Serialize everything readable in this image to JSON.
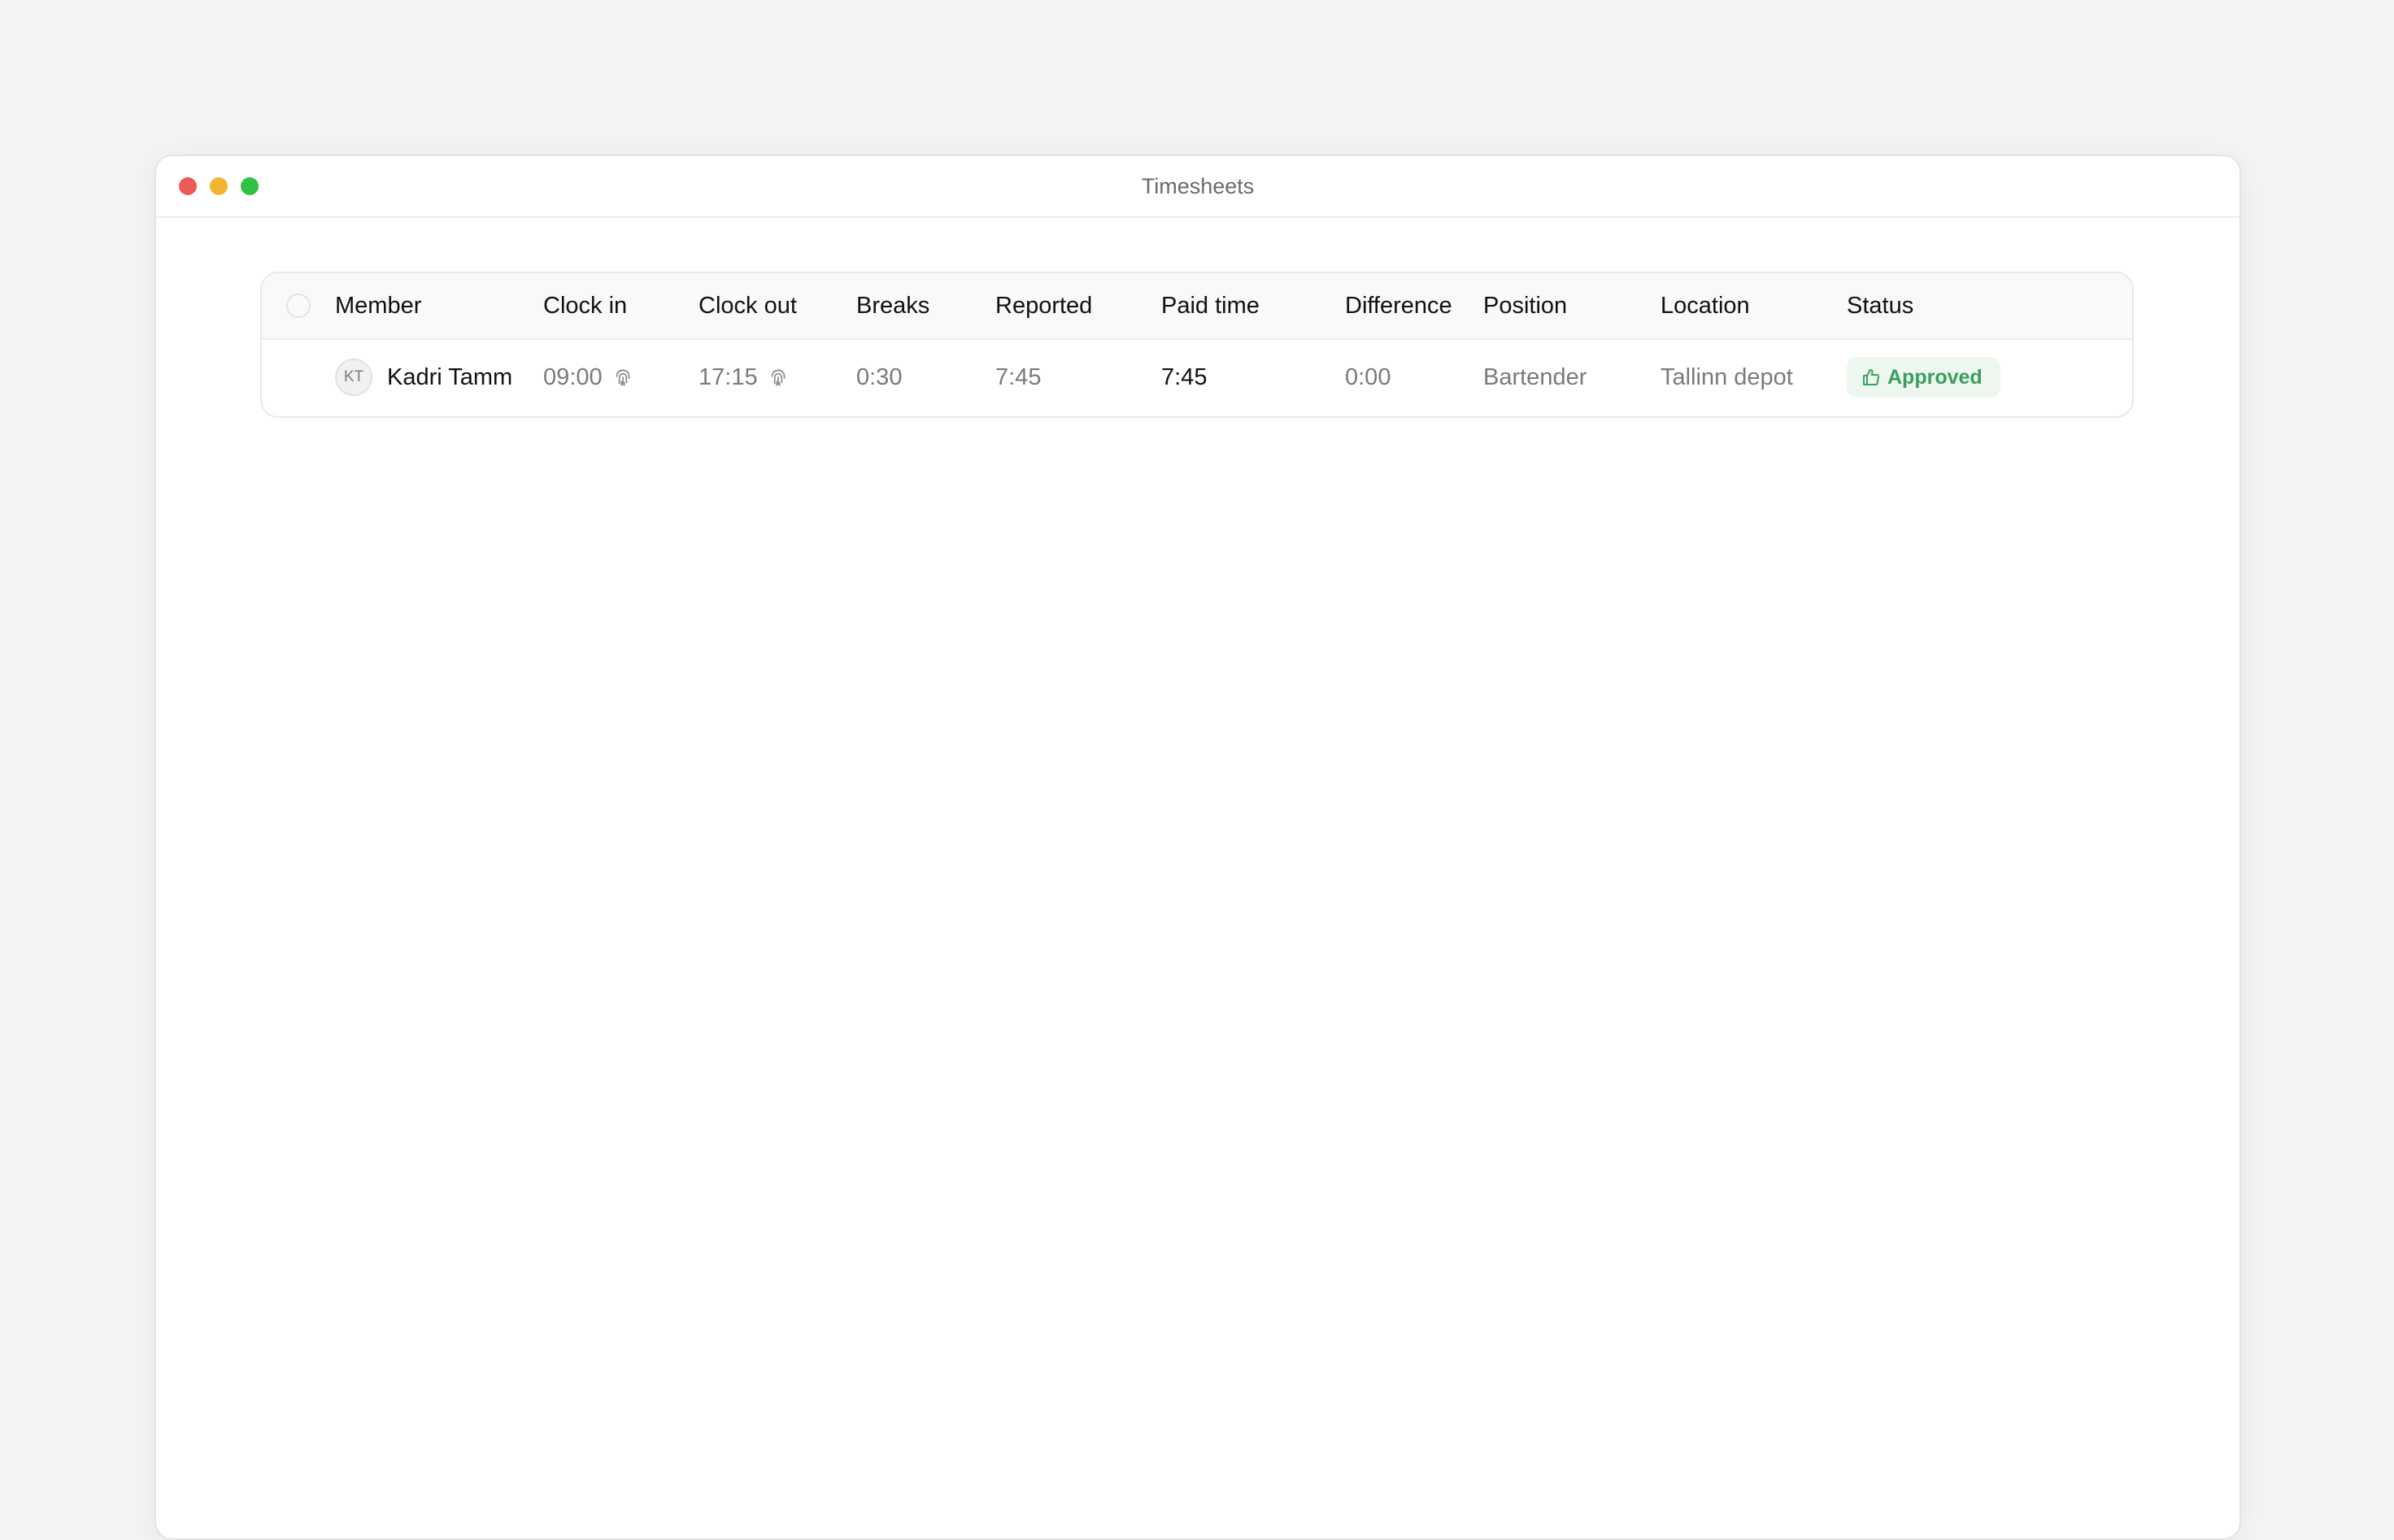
{
  "window": {
    "title": "Timesheets",
    "controls": {
      "close_color": "#ec5b55",
      "minimize_color": "#f3b52f",
      "maximize_color": "#30c242"
    }
  },
  "table": {
    "columns": [
      "Member",
      "Clock in",
      "Clock out",
      "Breaks",
      "Reported",
      "Paid time",
      "Difference",
      "Position",
      "Location",
      "Status"
    ],
    "rows": [
      {
        "member_initials": "KT",
        "member": "Kadri Tamm",
        "clock_in": "09:00",
        "clock_in_icon": "fingerprint-icon",
        "clock_out": "17:15",
        "clock_out_icon": "fingerprint-icon",
        "breaks": "0:30",
        "reported": "7:45",
        "paid_time": "7:45",
        "difference": "0:00",
        "position": "Bartender",
        "location": "Tallinn depot",
        "status": "Approved",
        "status_icon": "thumbs-up-icon",
        "status_color": "#3a9e5e",
        "status_bg": "#edf7f0"
      }
    ]
  }
}
